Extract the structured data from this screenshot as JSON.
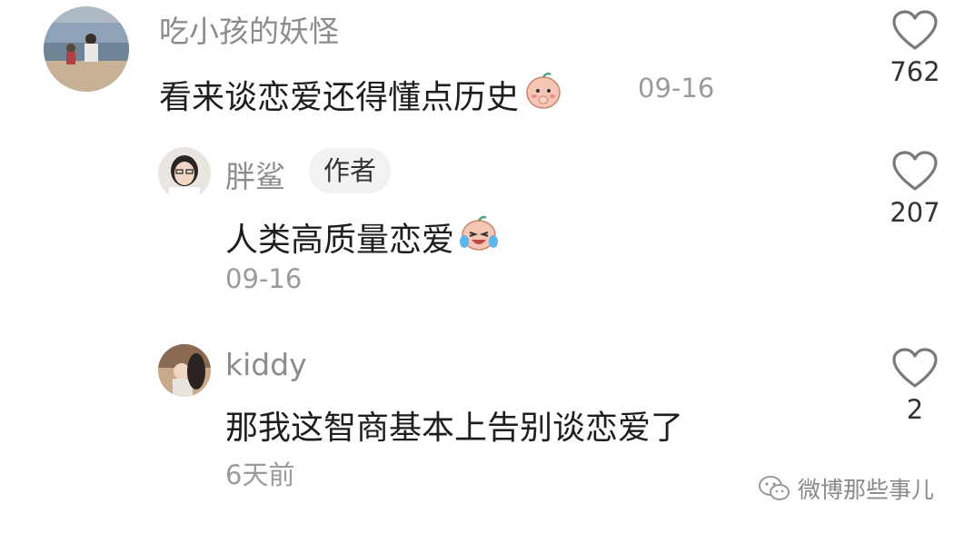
{
  "comments": [
    {
      "username": "吃小孩的妖怪",
      "text": "看来谈恋爱还得懂点历史",
      "emoji": "shy-baby-emoji",
      "time": "09-16",
      "likes": "762"
    },
    {
      "username": "胖鲨",
      "badge": "作者",
      "text": "人类高质量恋爱",
      "emoji": "laugh-cry-baby-emoji",
      "time": "09-16",
      "likes": "207"
    },
    {
      "username": "kiddy",
      "text": "那我这智商基本上告别谈恋爱了",
      "time": "6天前",
      "likes": "2"
    }
  ],
  "watermark": {
    "text": "微博那些事儿",
    "icon": "wechat-icon"
  }
}
